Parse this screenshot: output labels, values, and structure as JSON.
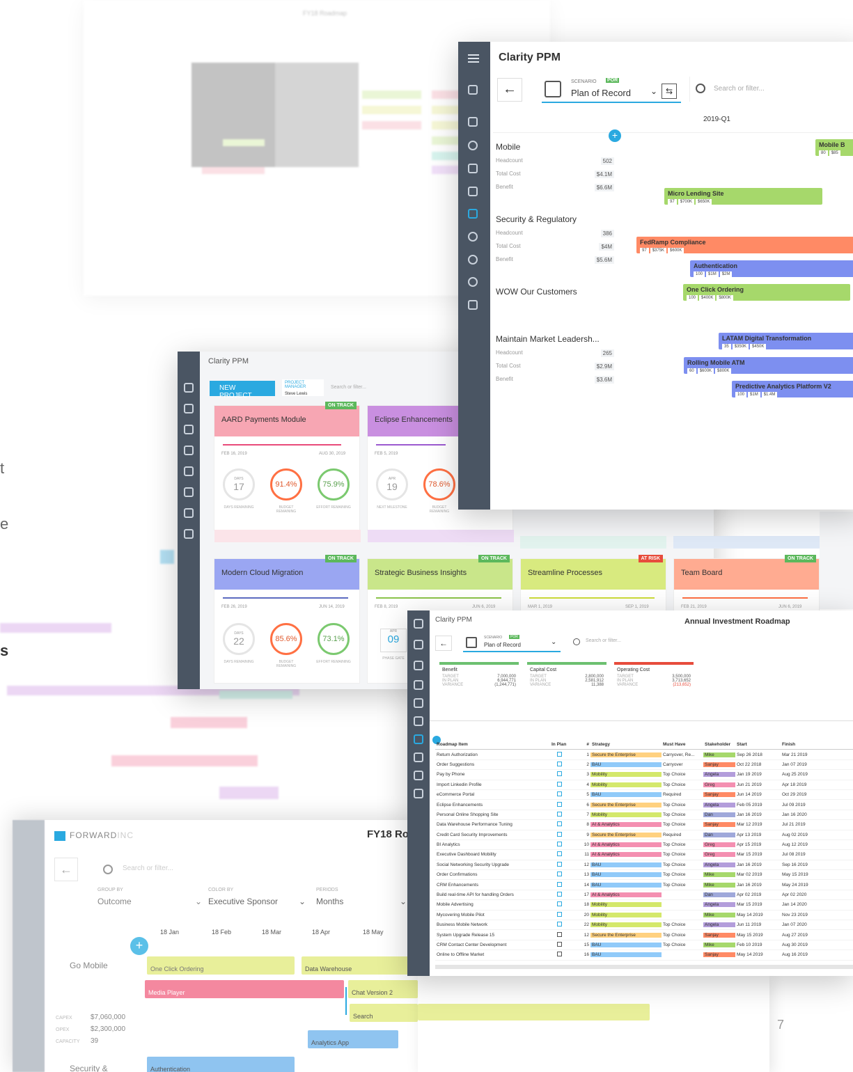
{
  "colors": {
    "accent": "#2aa9e0",
    "sidebar": "#4a5563",
    "green": "#a6d86b",
    "orange": "#ff8a65",
    "blue": "#7d8ff0",
    "lime": "#d4e86b",
    "pink": "#f27a9a",
    "purple": "#c98fe0"
  },
  "back_window": {
    "title": "FY18 Roadmap"
  },
  "main_window": {
    "app_title": "Clarity PPM",
    "scenario_label": "SCENARIO",
    "scenario_badge": "POR",
    "scenario_value": "Plan of Record",
    "search_placeholder": "Search or filter...",
    "period": "2019-Q1",
    "groups": [
      {
        "name": "Mobile",
        "rows": [
          {
            "label": "Headcount",
            "value": "502"
          },
          {
            "label": "Total Cost",
            "value": "$4.1M"
          },
          {
            "label": "Benefit",
            "value": "$6.6M"
          }
        ]
      },
      {
        "name": "Security & Regulatory",
        "rows": [
          {
            "label": "Headcount",
            "value": "386"
          },
          {
            "label": "Total Cost",
            "value": "$4M"
          },
          {
            "label": "Benefit",
            "value": "$5.6M"
          }
        ]
      },
      {
        "name": "WOW Our Customers",
        "rows": []
      },
      {
        "name": "Maintain Market Leadersh...",
        "rows": [
          {
            "label": "Headcount",
            "value": "265"
          },
          {
            "label": "Total Cost",
            "value": "$2.9M"
          },
          {
            "label": "Benefit",
            "value": "$3.6M"
          }
        ]
      }
    ],
    "bars": [
      {
        "name": "Mobile B",
        "chips": [
          "80",
          "$85"
        ]
      },
      {
        "name": "Micro Lending Site",
        "chips": [
          "97",
          "$700K",
          "$650K"
        ]
      },
      {
        "name": "FedRamp Compliance",
        "chips": [
          "97",
          "$375K",
          "$600K"
        ]
      },
      {
        "name": "Authentication",
        "chips": [
          "100",
          "$1M",
          "$2M"
        ]
      },
      {
        "name": "One Click Ordering",
        "chips": [
          "100",
          "$400K",
          "$800K"
        ]
      },
      {
        "name": "LATAM Digital Transformation",
        "chips": [
          "35",
          "$350K",
          "$450K"
        ]
      },
      {
        "name": "Rolling Mobile ATM",
        "chips": [
          "60",
          "$600K",
          "$800K"
        ]
      },
      {
        "name": "Predictive Analytics Platform V2",
        "chips": [
          "100",
          "$1M",
          "$1.4M"
        ]
      }
    ]
  },
  "cards_window": {
    "app_title": "Clarity PPM",
    "new_project": "NEW PROJECT",
    "filter_label": "PROJECT MANAGER",
    "filter_value": "Steve Lewis",
    "search_placeholder": "Search or filter...",
    "cards": [
      {
        "title": "AARD Payments Module",
        "status": "ON TRACK",
        "start": "FEB 16, 2019",
        "end": "AUG 30, 2019",
        "days_label": "DAYS",
        "days": "17",
        "metric1": "91.4%",
        "metric2": "75.9%",
        "labels": [
          "DAYS REMAINING",
          "BUDGET REMAINING",
          "EFFORT REMAINING"
        ]
      },
      {
        "title": "Eclipse Enhancements",
        "status": "",
        "start": "FEB 5, 2019",
        "end": "",
        "days_label": "APR",
        "days": "19",
        "metric1": "78.6%",
        "metric2": "",
        "labels": [
          "NEXT MILESTONE",
          "BUDGET REMAINING",
          ""
        ]
      },
      {
        "title": "Modern Cloud Migration",
        "status": "ON TRACK",
        "start": "FEB 26, 2019",
        "end": "JUN 14, 2019",
        "days_label": "DAYS",
        "days": "22",
        "metric1": "85.6%",
        "metric2": "73.1%",
        "labels": [
          "DAYS REMAINING",
          "BUDGET REMAINING",
          "EFFORT REMAINING"
        ]
      },
      {
        "title": "Strategic Business Insights",
        "status": "ON TRACK",
        "start": "FEB 8, 2019",
        "end": "JUN 6, 2019",
        "days_label": "APR",
        "days": "09",
        "metric1": "",
        "metric2": "",
        "labels": [
          "PHASE GATE",
          "",
          ""
        ]
      },
      {
        "title": "Streamline Processes",
        "status": "AT RISK",
        "start": "MAR 1, 2019",
        "end": "SEP 1, 2019"
      },
      {
        "title": "Team Board",
        "status": "ON TRACK",
        "start": "FEB 21, 2019",
        "end": "JUN 6, 2019"
      }
    ]
  },
  "table_window": {
    "app_title": "Clarity PPM",
    "heading": "Annual Investment Roadmap",
    "scenario_label": "SCENARIO",
    "scenario_badge": "POR",
    "scenario_value": "Plan of Record",
    "search_placeholder": "Search or filter...",
    "summaries": [
      {
        "title": "Benefit",
        "rows": [
          [
            "TARGET",
            "7,000,000"
          ],
          [
            "IN PLAN",
            "6,944,771"
          ],
          [
            "VARIANCE",
            "(1,244,771)"
          ]
        ]
      },
      {
        "title": "Capital Cost",
        "rows": [
          [
            "TARGET",
            "2,800,000"
          ],
          [
            "IN PLAN",
            "2,581,912"
          ],
          [
            "VARIANCE",
            "11,388"
          ]
        ]
      },
      {
        "title": "Operating Cost",
        "rows": [
          [
            "TARGET",
            "3,500,000"
          ],
          [
            "IN PLAN",
            "3,713,652"
          ],
          [
            "VARIANCE",
            "(213,652)"
          ]
        ]
      }
    ],
    "columns": [
      "Roadmap Item",
      "In Plan",
      "#",
      "Strategy",
      "Must Have",
      "Stakeholder",
      "Start",
      "Finish"
    ],
    "rows": [
      [
        "Return Authorization",
        "1",
        "Secure the Enterprise",
        "Carryover, Re...",
        "Mike",
        "Sep 26 2018",
        "Mar 21 2019"
      ],
      [
        "Order Suggestions",
        "2",
        "BAU",
        "Carryover",
        "Sanjay",
        "Oct 22 2018",
        "Jan 07 2019"
      ],
      [
        "Pay by Phone",
        "3",
        "Mobility",
        "Top Choice",
        "Angela",
        "Jan 19 2019",
        "Aug 25 2019"
      ],
      [
        "Import Linkedin Profile",
        "4",
        "Mobility",
        "Top Choice",
        "Greg",
        "Jun 21 2019",
        "Apr 18 2019"
      ],
      [
        "eCommerce Portal",
        "5",
        "BAU",
        "Required",
        "Sanjay",
        "Jun 14 2019",
        "Oct 29 2019"
      ],
      [
        "Eclipse Enhancements",
        "6",
        "Secure the Enterprise",
        "Top Choice",
        "Angela",
        "Feb 05 2019",
        "Jul 09 2019"
      ],
      [
        "Personal Online Shopping Site",
        "7",
        "Mobility",
        "Top Choice",
        "Dan",
        "Jan 16 2019",
        "Jan 16 2020"
      ],
      [
        "Data Warehouse Performance Tuning",
        "8",
        "AI & Analytics",
        "Top Choice",
        "Sanjay",
        "Mar 12 2019",
        "Jul 21 2019"
      ],
      [
        "Credit Card Security Improvements",
        "9",
        "Secure the Enterprise",
        "Required",
        "Dan",
        "Apr 13 2019",
        "Aug 02 2019"
      ],
      [
        "BI Analytics",
        "10",
        "AI & Analytics",
        "Top Choice",
        "Greg",
        "Apr 15 2019",
        "Aug 12 2019"
      ],
      [
        "Executive Dashboard Mobility",
        "11",
        "AI & Analytics",
        "Top Choice",
        "Greg",
        "Mar 15 2019",
        "Jul 08 2019"
      ],
      [
        "Social Networking Security Upgrade",
        "12",
        "BAU",
        "Top Choice",
        "Angela",
        "Jan 16 2019",
        "Sep 16 2019"
      ],
      [
        "Order Confirmations",
        "13",
        "BAU",
        "Top Choice",
        "Mike",
        "Mar 02 2019",
        "May 15 2019"
      ],
      [
        "CRM Enhancements",
        "14",
        "BAU",
        "Top Choice",
        "Mike",
        "Jan 16 2019",
        "May 24 2019"
      ],
      [
        "Build real-time API for handling Orders",
        "17",
        "AI & Analytics",
        "",
        "Dan",
        "Apr 02 2019",
        "Apr 02 2020"
      ],
      [
        "Mobile Advertising",
        "18",
        "Mobility",
        "",
        "Angela",
        "Mar 15 2019",
        "Jan 14 2020"
      ],
      [
        "Mycovering Mobile Pilot",
        "20",
        "Mobility",
        "",
        "Mike",
        "May 14 2019",
        "Nov 23 2019"
      ],
      [
        "Business Mobile Network",
        "22",
        "Mobility",
        "Top Choice",
        "Angela",
        "Jun 11 2019",
        "Jan 07 2020"
      ],
      [
        "System Upgrade Release 15",
        "12",
        "Secure the Enterprise",
        "Top Choice",
        "Sanjay",
        "May 15 2019",
        "Aug 27 2019"
      ],
      [
        "CRM Contact Center Development",
        "15",
        "BAU",
        "Top Choice",
        "Mike",
        "Feb 10 2019",
        "Aug 30 2019"
      ],
      [
        "Online to Offline Market",
        "16",
        "BAU",
        "",
        "Sanjay",
        "May 14 2019",
        "Aug 16 2019"
      ]
    ]
  },
  "front_window": {
    "brand": "FORWARD",
    "brand_suffix": "INC",
    "title": "FY18 Ro",
    "search_placeholder": "Search or filter...",
    "groupby_label": "GROUP BY",
    "groupby_value": "Outcome",
    "colorby_label": "COLOR BY",
    "colorby_value": "Executive Sponsor",
    "periods_label": "PERIODS",
    "periods_value": "Months",
    "months": [
      "18 Jan",
      "18 Feb",
      "18 Mar",
      "18 Apr",
      "18 May"
    ],
    "group": "Go Mobile",
    "stats": [
      [
        "CAPEX",
        "$7,060,000"
      ],
      [
        "OPEX",
        "$2,300,000"
      ],
      [
        "CAPACITY",
        "39"
      ]
    ],
    "group2": "Security &",
    "bars": [
      "One Click Ordering",
      "Data Warehouse",
      "Media Player",
      "Chat Version 2",
      "Search",
      "Analytics App",
      "Authentication"
    ]
  },
  "page_number": "7"
}
